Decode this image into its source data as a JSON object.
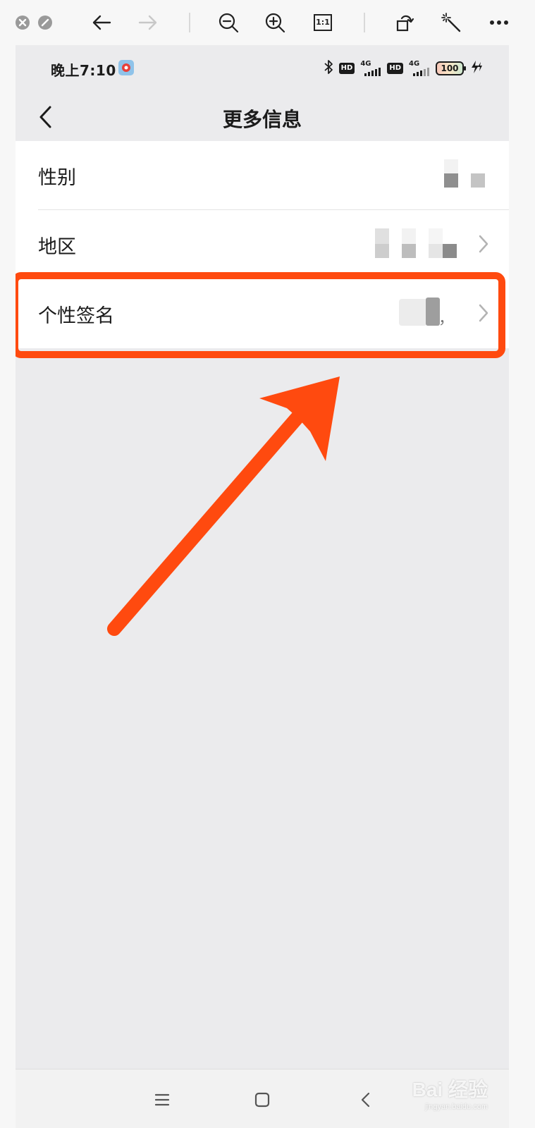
{
  "viewer_toolbar": {
    "icons": [
      "close-icon",
      "minimize-icon",
      "back-arrow-icon",
      "forward-arrow-icon",
      "zoom-out-icon",
      "zoom-in-icon",
      "actual-size-icon",
      "rotate-icon",
      "magic-wand-icon",
      "more-icon"
    ],
    "actual_size_label": "1:1"
  },
  "status_bar": {
    "time": "晚上7:10",
    "hd_label": "HD",
    "network_label": "4G",
    "battery": "100"
  },
  "nav": {
    "title": "更多信息"
  },
  "list": {
    "items": [
      {
        "label": "性别",
        "has_chevron": false
      },
      {
        "label": "地区",
        "has_chevron": true
      },
      {
        "label": "个性签名",
        "has_chevron": true,
        "value_suffix": "，"
      }
    ]
  },
  "annotation": {
    "highlight_color": "#ff4a0f",
    "highlighted_item": "个性签名"
  },
  "bottom_nav": {
    "icons": [
      "menu-icon",
      "home-icon",
      "back-icon"
    ]
  },
  "watermark": {
    "text": "Bai 经验",
    "subtext": "jingyan.baidu.com"
  }
}
